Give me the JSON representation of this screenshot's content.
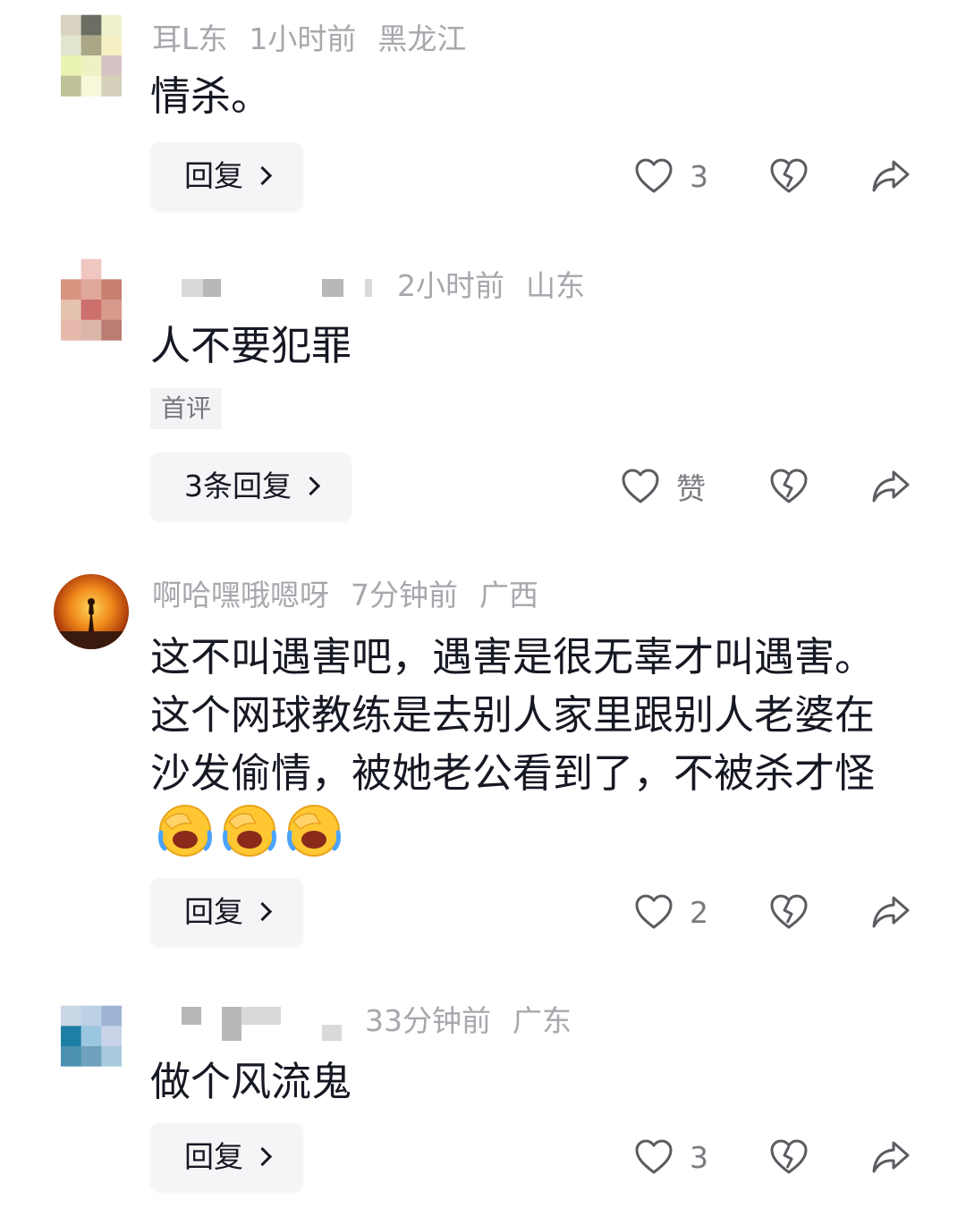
{
  "comments": [
    {
      "username": "耳L东",
      "time": "1小时前",
      "location": "黑龙江",
      "text": "情杀。",
      "reply_label": "回复",
      "like_count": "3",
      "avatar_colors": [
        "#d8d3c2",
        "#6c6d63",
        "#f0f2cf",
        "#e2e4cd",
        "#a9a786",
        "#f5f1c4",
        "#e9f3b2",
        "#eef2c3",
        "#d6c4c4",
        "#bfc297",
        "#f7f8d9",
        "#d4d0ba"
      ]
    },
    {
      "username_hidden": true,
      "time": "2小时前",
      "location": "山东",
      "text": "人不要犯罪",
      "tag": "首评",
      "reply_label": "3条回复",
      "like_label": "赞",
      "avatar_colors": [
        "#ffffff",
        "#f0c6c0",
        "#ffffff",
        "#d8957f",
        "#e0a79b",
        "#c9806f",
        "#e4c2ae",
        "#cd6f6d",
        "#d79b8d",
        "#e7b8ac",
        "#dcb6a9",
        "#b97d73"
      ]
    },
    {
      "username": "啊哈嘿哦嗯呀",
      "time": "7分钟前",
      "location": "广西",
      "text": "这不叫遇害吧，遇害是很无辜才叫遇害。这个网球教练是去别人家里跟别人老婆在沙发偷情，被她老公看到了，不被杀才怪",
      "emoji_names": [
        "facepalm-laugh-icon",
        "facepalm-laugh-icon",
        "facepalm-laugh-icon"
      ],
      "reply_label": "回复",
      "like_count": "2"
    },
    {
      "username_hidden": true,
      "time": "33分钟前",
      "location": "广东",
      "text": "做个风流鬼",
      "reply_label": "回复",
      "like_count": "3",
      "avatar_colors": [
        "#c9d7e4",
        "#bcd0e6",
        "#9fb4d4",
        "#1d7fa6",
        "#9bc6df",
        "#c8d3e8",
        "#4b90b0",
        "#6fa1bd",
        "#a8c9db",
        "#ffffff",
        "#ffffff",
        "#ffffff"
      ]
    }
  ],
  "colors": {
    "text": "#161823",
    "meta": "#a7a8ad",
    "button_bg": "#f5f5f7"
  }
}
